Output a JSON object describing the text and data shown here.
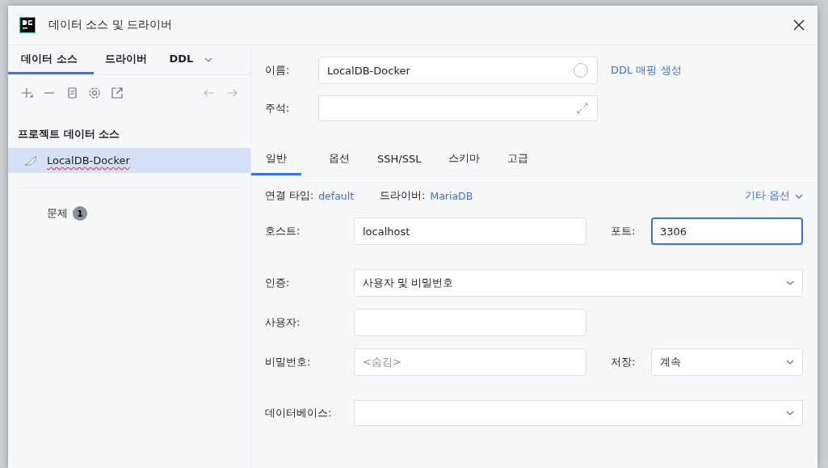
{
  "window": {
    "title": "데이터 소스 및 드라이버"
  },
  "sidebar": {
    "tabs": [
      {
        "label": "데이터 소스",
        "selected": true
      },
      {
        "label": "드라이버",
        "selected": false
      },
      {
        "label": "DDL",
        "selected": false
      }
    ],
    "section_title": "프로젝트 데이터 소스",
    "items": [
      {
        "label": "LocalDB-Docker",
        "selected": true
      }
    ],
    "problems": {
      "label": "문제",
      "count": "1"
    }
  },
  "form": {
    "name": {
      "label": "이름:",
      "value": "LocalDB-Docker"
    },
    "ddl_link": "DDL 매핑 생성",
    "comment": {
      "label": "주석:"
    },
    "tabs": [
      {
        "label": "일반",
        "selected": true
      },
      {
        "label": "옵션",
        "selected": false
      },
      {
        "label": "SSH/SSL",
        "selected": false
      },
      {
        "label": "스키마",
        "selected": false
      },
      {
        "label": "고급",
        "selected": false
      }
    ],
    "connection_type": {
      "label": "연결 타입:",
      "value": "default"
    },
    "driver": {
      "label": "드라이버:",
      "value": "MariaDB"
    },
    "more_options": "기타 옵션",
    "host": {
      "label": "호스트:",
      "value": "localhost"
    },
    "port": {
      "label": "포트:",
      "value": "3306",
      "focused": true
    },
    "auth": {
      "label": "인증:",
      "value": "사용자 및 비밀번호"
    },
    "user": {
      "label": "사용자:"
    },
    "password": {
      "label": "비밀번호:",
      "placeholder": "<숨김>"
    },
    "save": {
      "label": "저장:",
      "value": "계속"
    },
    "database": {
      "label": "데이터베이스:"
    }
  }
}
